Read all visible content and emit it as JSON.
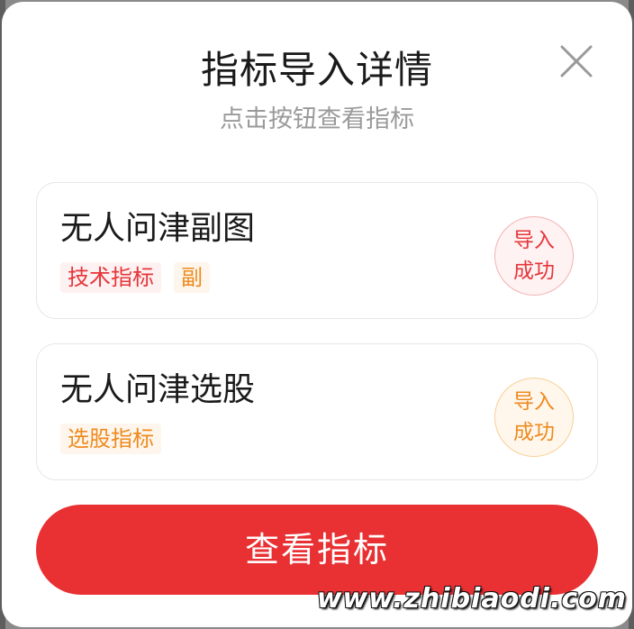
{
  "dialog": {
    "title": "指标导入详情",
    "subtitle": "点击按钮查看指标",
    "close_icon": "close-icon",
    "items": [
      {
        "name": "无人问津副图",
        "tags": [
          {
            "label": "技术指标",
            "color": "#e6363a"
          },
          {
            "label": "副",
            "color": "#ee8a1f"
          }
        ],
        "status_line1": "导入",
        "status_line2": "成功",
        "status_color": "#e6363a"
      },
      {
        "name": "无人问津选股",
        "tags": [
          {
            "label": "选股指标",
            "color": "#ee8a1f"
          }
        ],
        "status_line1": "导入",
        "status_line2": "成功",
        "status_color": "#ee8a1f"
      }
    ],
    "action_label": "查看指标",
    "action_color": "#e93033"
  },
  "watermark": "www.zhibiaodi.com"
}
